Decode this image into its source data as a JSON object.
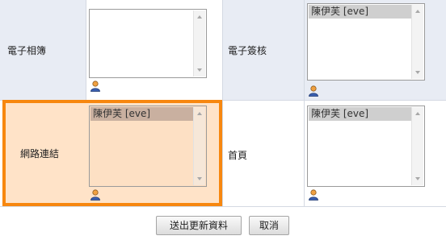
{
  "form": {
    "rows": [
      {
        "left": {
          "label": "電子相簿",
          "selected": ""
        },
        "right": {
          "label": "電子簽核",
          "selected": "陳伊芙 [eve]"
        }
      },
      {
        "left": {
          "label": "網路連結",
          "selected": "陳伊芙 [eve]"
        },
        "right": {
          "label": "首頁",
          "selected": "陳伊芙 [eve]"
        }
      }
    ]
  },
  "buttons": {
    "submit": "送出更新資料",
    "cancel": "取消"
  },
  "colors": {
    "highlight_border": "#f7870f",
    "highlight_fill": "#ffe3c8",
    "label_cell": "#e8ecf4"
  },
  "icons": {
    "user_picker": "user-icon",
    "scroll_up": "chevron-up-icon",
    "scroll_down": "chevron-down-icon"
  }
}
